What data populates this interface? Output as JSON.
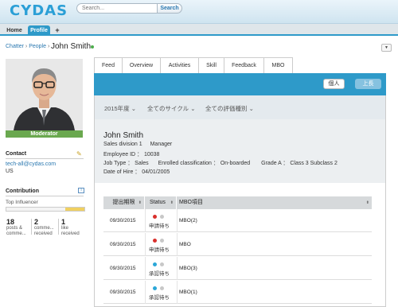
{
  "header": {
    "logo": "CYDAS",
    "search_placeholder": "Search...",
    "search_label": "Search"
  },
  "tabs": {
    "home": "Home",
    "profile": "Profile",
    "add": "+"
  },
  "breadcrumb": {
    "chatter": "Chatter",
    "sep": " › ",
    "people": "People",
    "sep2": " ›",
    "current": "John Smith"
  },
  "sidebar": {
    "badge": "Moderator",
    "contact_title": "Contact",
    "email": "tech-all@cydas.com",
    "country": "US",
    "contribution_title": "Contribution",
    "contribution_info": "i",
    "top_influencer": "Top Influencer",
    "influencer_level": 0.24,
    "stats": [
      {
        "num": "18",
        "label1": "posts &",
        "label2": "comme..."
      },
      {
        "num": "2",
        "label1": "comme...",
        "label2": "received"
      },
      {
        "num": "1",
        "label1": "like",
        "label2": "received"
      }
    ]
  },
  "profile_tabs": [
    "Feed",
    "Overview",
    "Activities",
    "Skill",
    "Feedback",
    "MBO"
  ],
  "mbo": {
    "btn_personal": "個人",
    "btn_boss": "上長",
    "filters": [
      "2015年度 ⌄",
      "全てのサイクル ⌄",
      "全ての評価種別 ⌄"
    ],
    "card": {
      "name": "John Smith",
      "division": "Sales division 1",
      "role": "Manager",
      "employee_id": "Employee ID ： 10038",
      "job_type": "Job Type ： Sales",
      "enrolled": "Enrolled classification ： On-boarded",
      "grade": "Grade A ： Class 3 Subclass 2",
      "hire_date": "Date of Hire ： 04/01/2005"
    },
    "table": {
      "headers": [
        "提出期限",
        "Status",
        "MBO項目"
      ],
      "sort_glyph": "⬍",
      "rows": [
        {
          "date": "09/30/2015",
          "status": "申請待ち",
          "item": "MBO(2)",
          "dot_color": "#d9302c"
        },
        {
          "date": "09/30/2015",
          "status": "申請待ち",
          "item": "MBO",
          "dot_color": "#d9302c"
        },
        {
          "date": "09/30/2015",
          "status": "承認待ち",
          "item": "MBO(3)",
          "dot_color": "#2ba7d8"
        },
        {
          "date": "09/30/2015",
          "status": "承認待ち",
          "item": "MBO(1)",
          "dot_color": "#2ba7d8"
        }
      ]
    }
  },
  "colors": {
    "brand": "#2e9ac9",
    "moderator": "#6aa84f",
    "link": "#2a78b0"
  }
}
